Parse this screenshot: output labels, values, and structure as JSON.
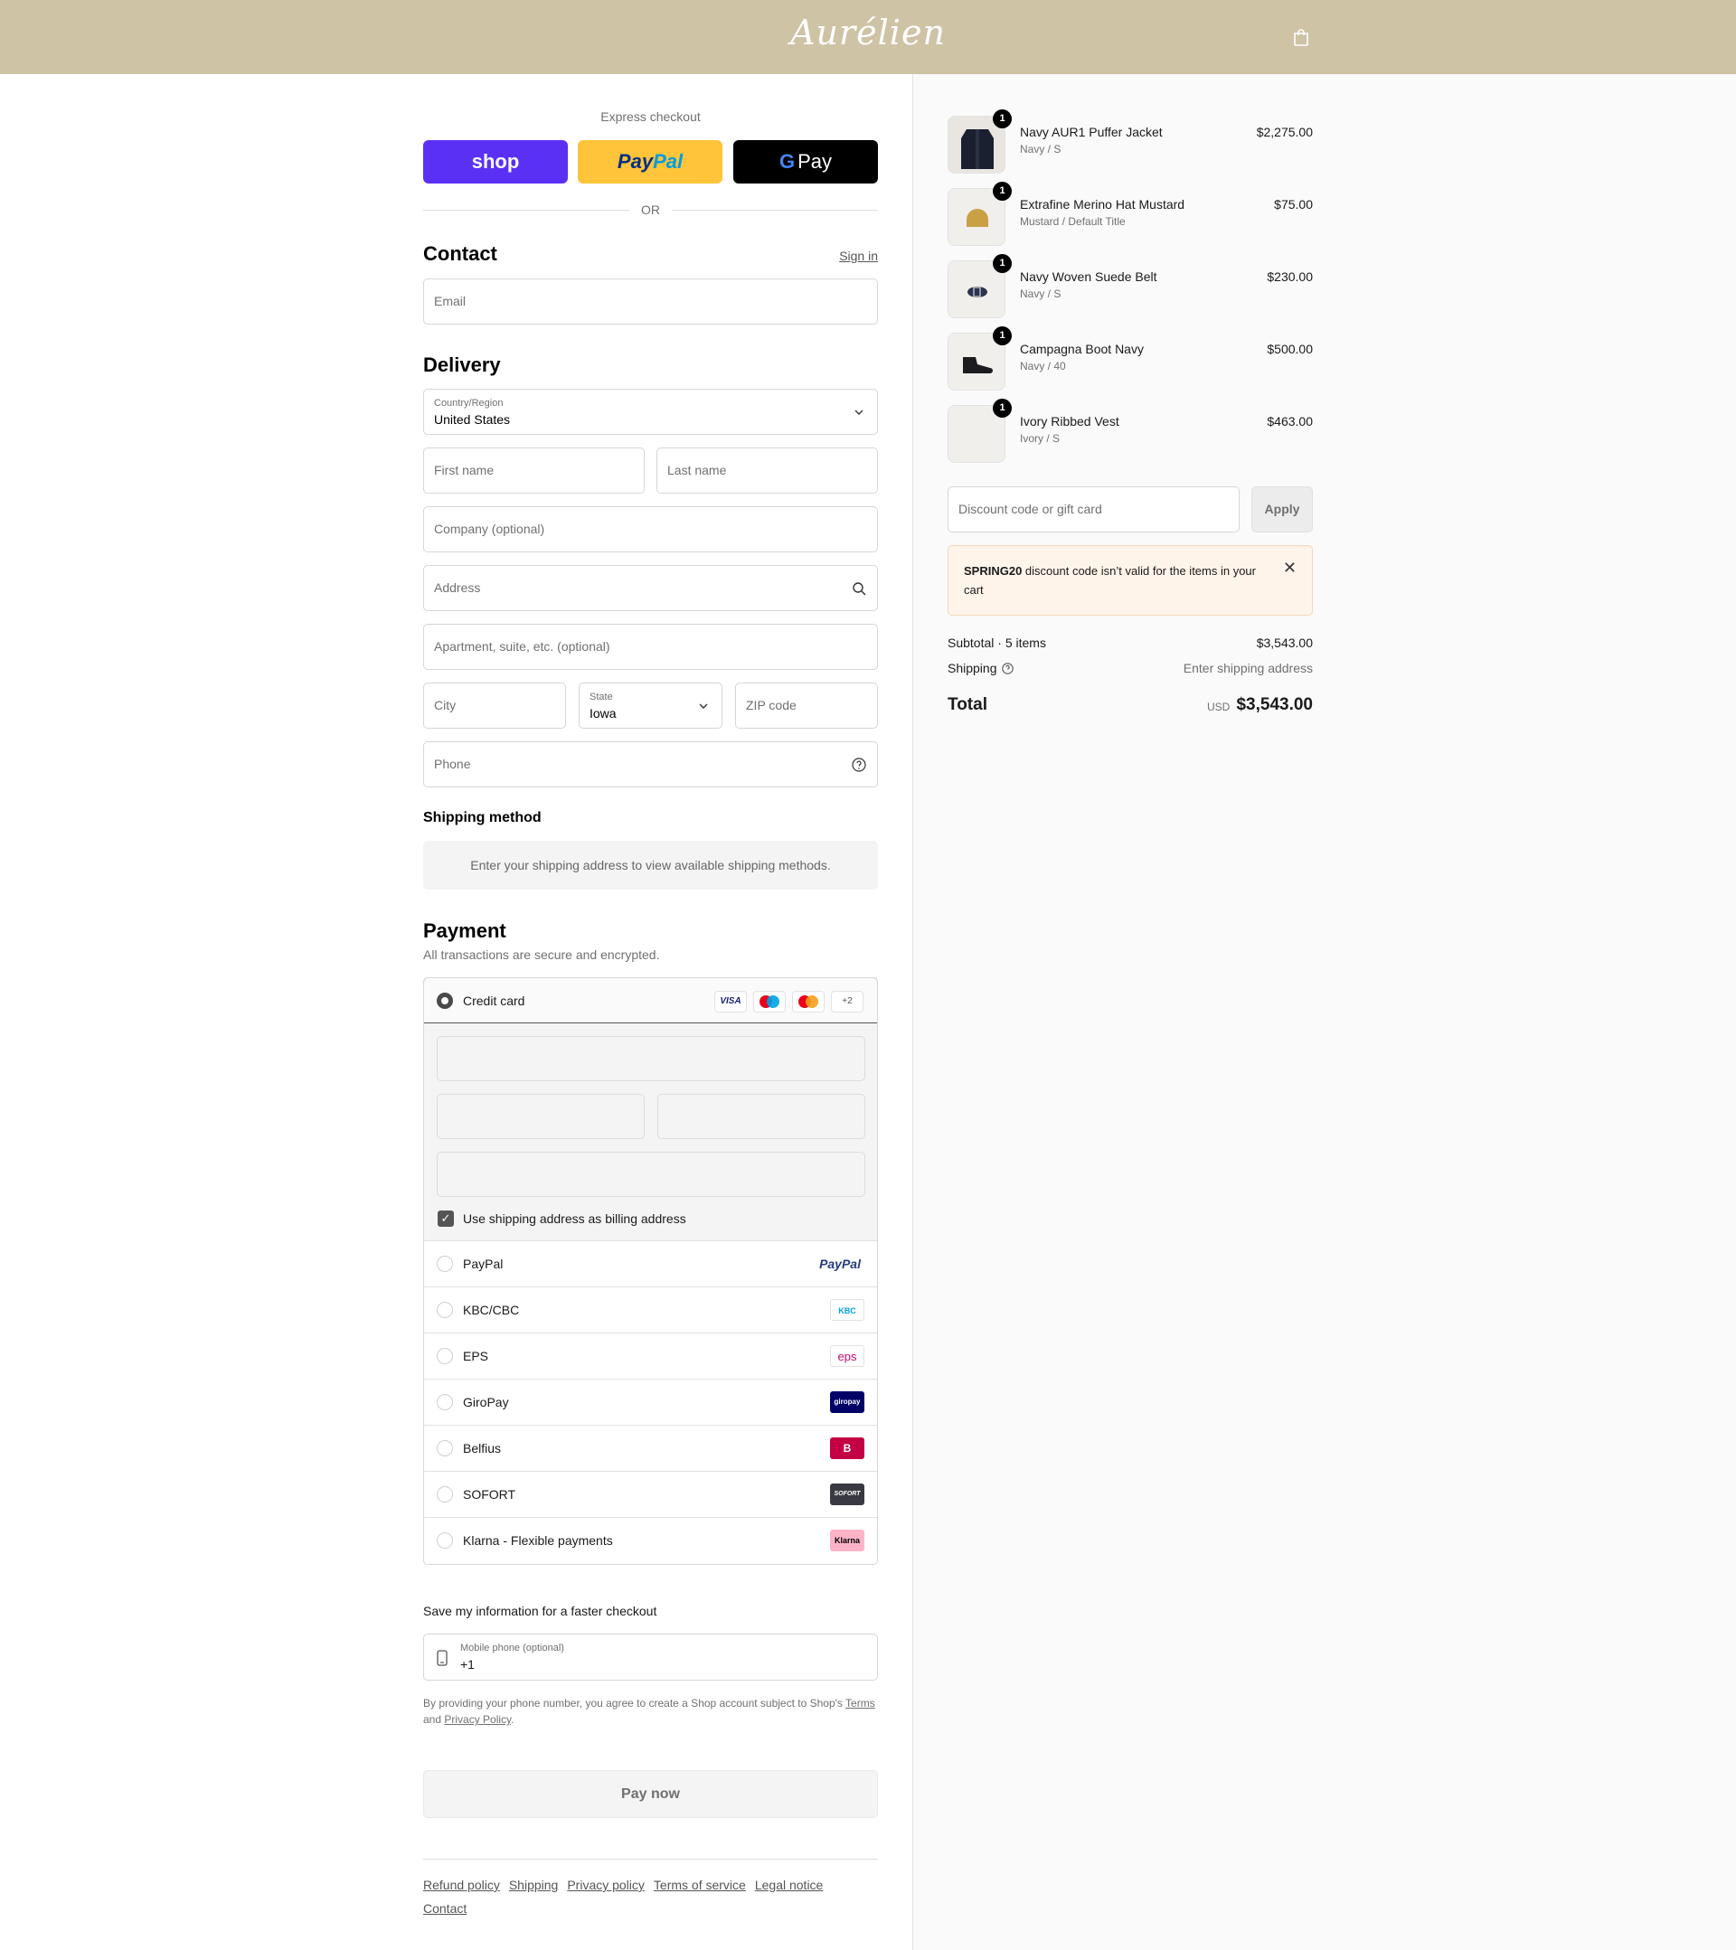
{
  "header": {
    "brand": "Aurélien"
  },
  "express": {
    "title": "Express checkout",
    "shop": "shop",
    "paypal": "PayPal",
    "gpay": "Pay",
    "or": "OR"
  },
  "contact": {
    "title": "Contact",
    "sign_in": "Sign in",
    "email_placeholder": "Email"
  },
  "delivery": {
    "title": "Delivery",
    "country_label": "Country/Region",
    "country_value": "United States",
    "first_name": "First name",
    "last_name": "Last name",
    "company": "Company (optional)",
    "address": "Address",
    "apartment": "Apartment, suite, etc. (optional)",
    "city": "City",
    "state_label": "State",
    "state_value": "Iowa",
    "zip": "ZIP code",
    "phone": "Phone"
  },
  "shipping": {
    "title": "Shipping method",
    "note": "Enter your shipping address to view available shipping methods."
  },
  "payment": {
    "title": "Payment",
    "subtitle": "All transactions are secure and encrypted.",
    "credit_card": "Credit card",
    "card_badges": [
      "VISA",
      "Maestro",
      "Mastercard",
      "+2"
    ],
    "billing_same": "Use shipping address as billing address",
    "methods": [
      {
        "label": "PayPal",
        "logo": "PayPal"
      },
      {
        "label": "KBC/CBC",
        "logo": "KBC"
      },
      {
        "label": "EPS",
        "logo": "eps"
      },
      {
        "label": "GiroPay",
        "logo": "giropay"
      },
      {
        "label": "Belfius",
        "logo": "B"
      },
      {
        "label": "SOFORT",
        "logo": "SOFORT"
      },
      {
        "label": "Klarna - Flexible payments",
        "logo": "Klarna"
      }
    ]
  },
  "save_info": {
    "title": "Save my information for a faster checkout",
    "mobile_label": "Mobile phone (optional)",
    "mobile_value": "+1",
    "disclaimer_pre": "By providing your phone number, you agree to create a Shop account subject to Shop's ",
    "terms": "Terms",
    "and": " and ",
    "privacy": "Privacy Policy",
    "end": "."
  },
  "pay_now": "Pay now",
  "footer": [
    "Refund policy",
    "Shipping",
    "Privacy policy",
    "Terms of service",
    "Legal notice",
    "Contact"
  ],
  "order": {
    "items": [
      {
        "name": "Navy AUR1 Puffer Jacket",
        "variant": "Navy / S",
        "price": "$2,275.00",
        "qty": "1"
      },
      {
        "name": "Extrafine Merino Hat Mustard",
        "variant": "Mustard / Default Title",
        "price": "$75.00",
        "qty": "1"
      },
      {
        "name": "Navy Woven Suede Belt",
        "variant": "Navy / S",
        "price": "$230.00",
        "qty": "1"
      },
      {
        "name": "Campagna Boot Navy",
        "variant": "Navy / 40",
        "price": "$500.00",
        "qty": "1"
      },
      {
        "name": "Ivory Ribbed Vest",
        "variant": "Ivory / S",
        "price": "$463.00",
        "qty": "1"
      }
    ],
    "discount_placeholder": "Discount code or gift card",
    "apply": "Apply",
    "alert_code": "SPRING20",
    "alert_text": " discount code isn’t valid for the items in your cart",
    "subtotal_label": "Subtotal · 5 items",
    "subtotal_value": "$3,543.00",
    "shipping_label": "Shipping",
    "shipping_value": "Enter shipping address",
    "total_label": "Total",
    "currency": "USD",
    "total_value": "$3,543.00"
  },
  "colors": {
    "header_bg": "#cfc3a6",
    "shop_purple": "#5a31f4",
    "paypal_yellow": "#ffc439",
    "alert_bg": "#fff4ea"
  }
}
